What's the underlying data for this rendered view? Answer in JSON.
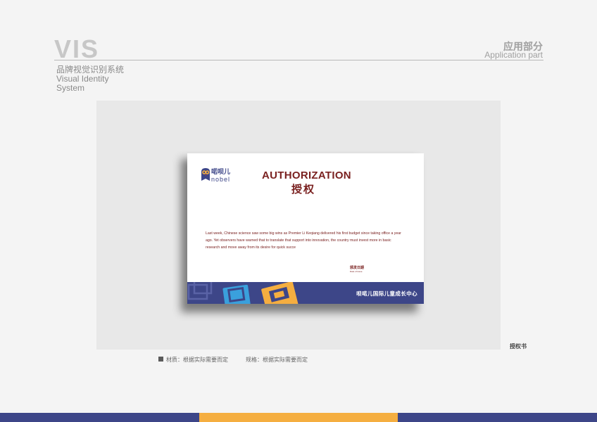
{
  "header": {
    "vis": "VIS",
    "subtitle_cn": "品牌视觉识别系统",
    "subtitle_en_1": "Visual Identity",
    "subtitle_en_2": "System",
    "section_cn": "应用部分",
    "section_en": "Application part"
  },
  "card": {
    "logo_cn": "喏呗儿",
    "logo_en": "nobel",
    "title_en": "AUTHORIZATION",
    "title_cn": "授权",
    "body": "Last week, Chinese science saw some big wins as Premier Li Keqiang delivered his first budget since taking office a year ago. Yet observers have warned that to translate that support into innovation, the country must invest more in basic research and move away from its desire for quick succe",
    "issue_cn": "颁发日期",
    "issue_en": "Date of issue",
    "band_text": "呗喏儿国际儿童成长中心"
  },
  "caption": "授权书",
  "spec": {
    "material": "材质：根据实际需要而定",
    "size": "规格：根据实际需要而定"
  },
  "colors": {
    "brand_navy": "#3d4688",
    "brand_orange": "#f5ae40",
    "brand_red": "#7a2120",
    "brand_blue": "#3aa0dc"
  }
}
